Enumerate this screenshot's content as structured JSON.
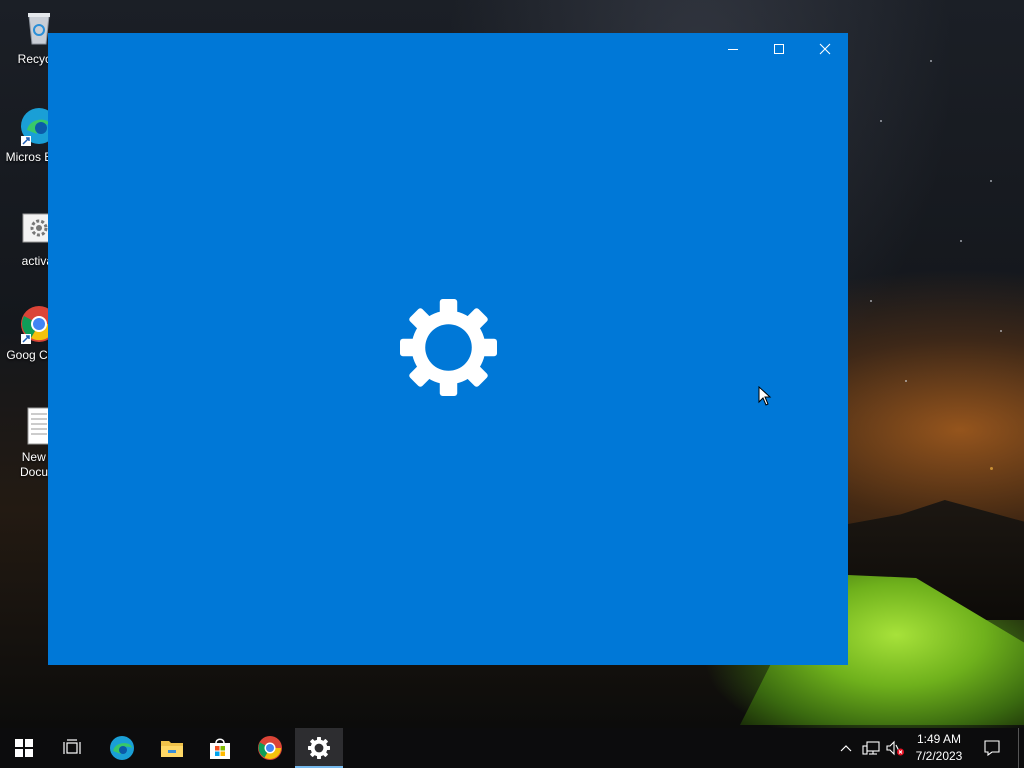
{
  "desktop": {
    "icons": [
      {
        "label": "Recycle"
      },
      {
        "label": "Micros Edge"
      },
      {
        "label": "activat"
      },
      {
        "label": "Goog Chron"
      },
      {
        "label": "New T Docum"
      }
    ]
  },
  "settings_window": {
    "background_color": "#0078d7",
    "controls": {
      "minimize": "minimize-icon",
      "maximize": "maximize-icon",
      "close": "close-icon"
    },
    "splash_icon": "gear-icon"
  },
  "taskbar": {
    "apps": [
      {
        "name": "start",
        "icon": "windows-logo-icon"
      },
      {
        "name": "task-view",
        "icon": "task-view-icon"
      },
      {
        "name": "edge",
        "icon": "edge-icon"
      },
      {
        "name": "file-explorer",
        "icon": "folder-icon"
      },
      {
        "name": "store",
        "icon": "store-icon"
      },
      {
        "name": "chrome",
        "icon": "chrome-icon"
      },
      {
        "name": "settings",
        "icon": "gear-icon",
        "active": true
      }
    ],
    "tray": {
      "time": "1:49 AM",
      "date": "7/2/2023"
    }
  }
}
